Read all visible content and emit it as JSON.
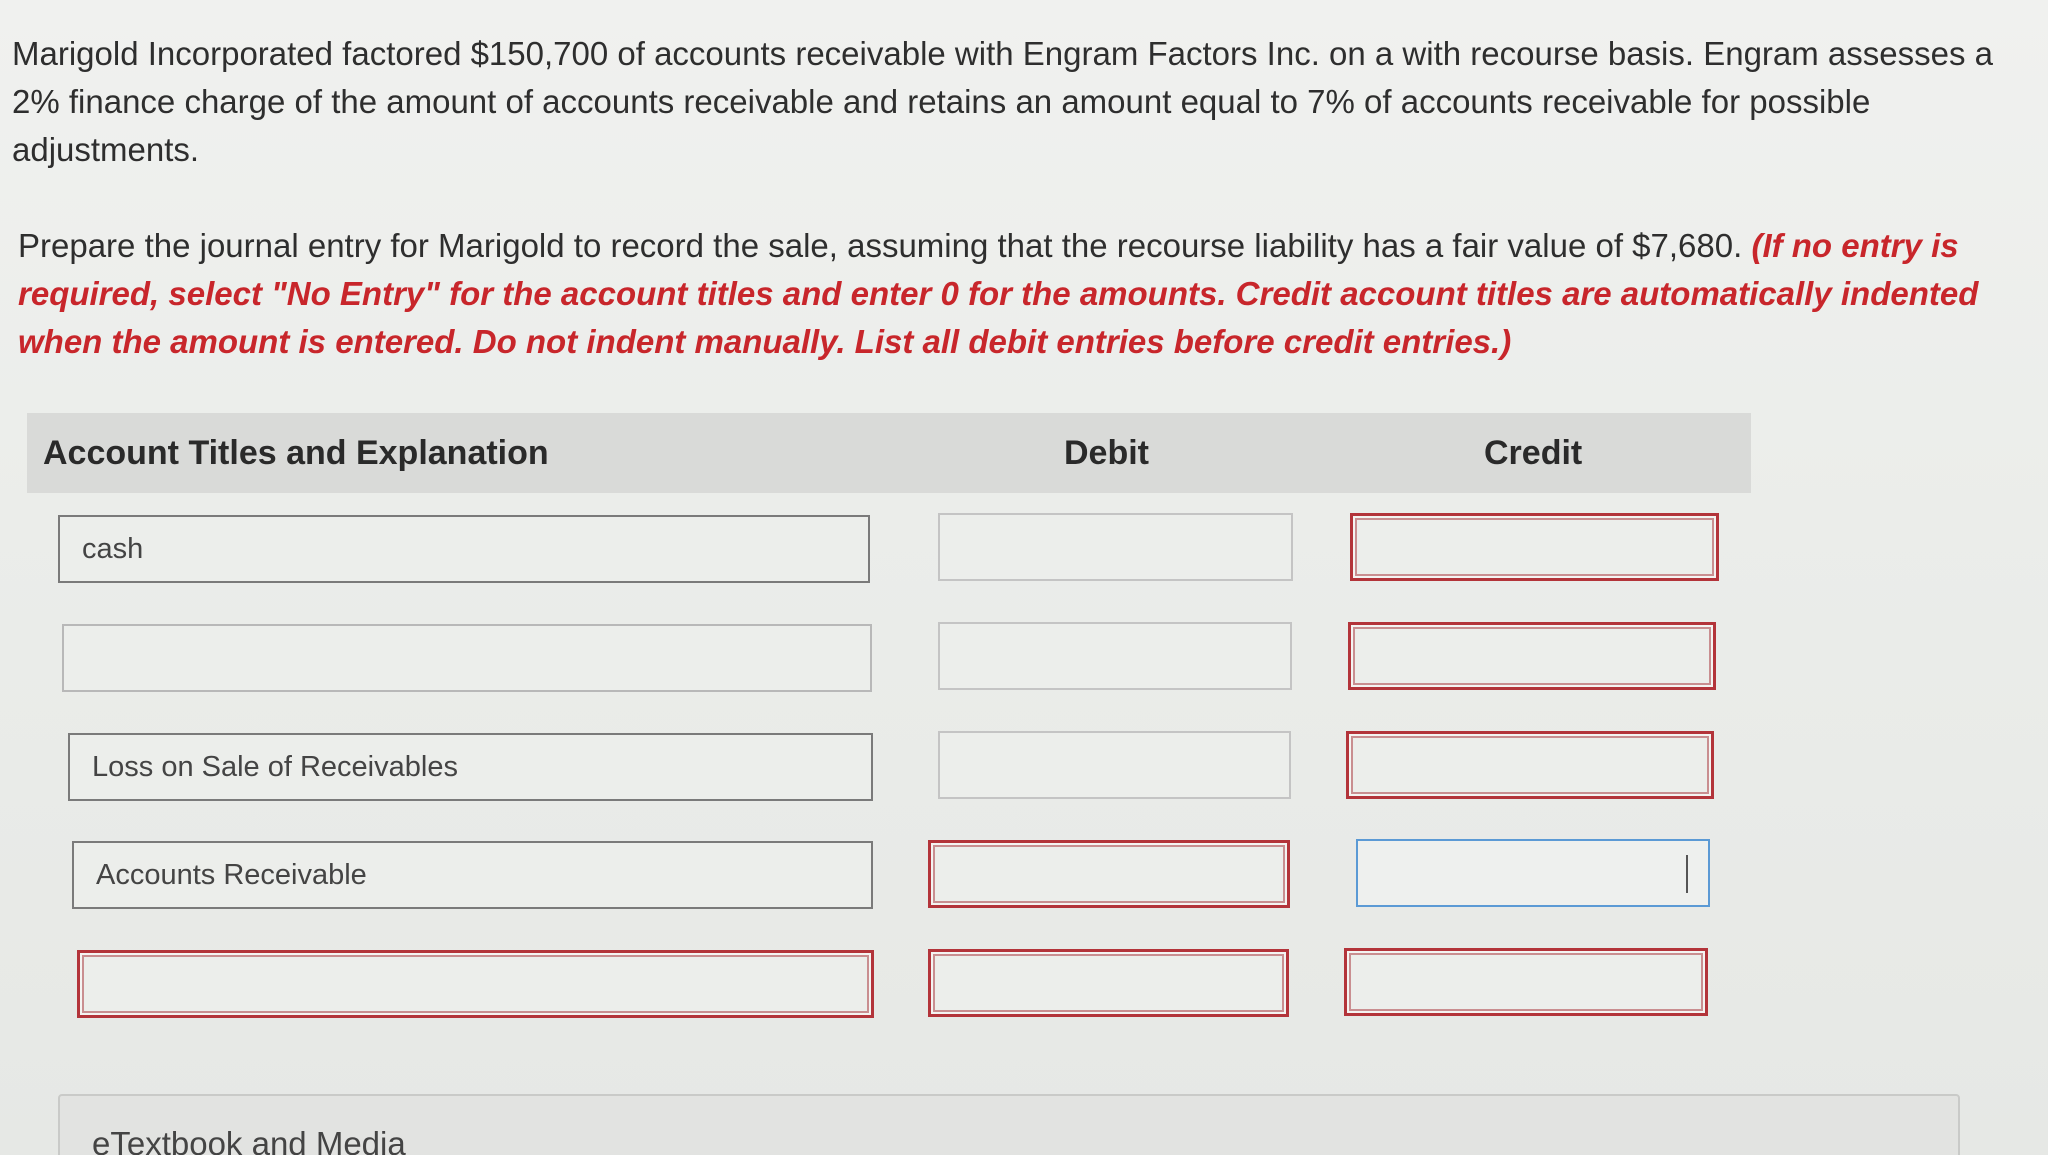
{
  "problem_text": "Marigold Incorporated factored $150,700 of accounts receivable with Engram Factors Inc. on a with recourse basis. Engram assesses a 2% finance charge of the amount of accounts receivable and retains an amount equal to 7% of accounts receivable for possible adjustments.",
  "instructions": {
    "text": "Prepare the journal entry for Marigold to record the sale, assuming that the recourse liability has a fair value of $7,680.",
    "note": "(If no entry is required, select \"No Entry\" for the account titles and enter 0 for the amounts. Credit account titles are automatically indented when the amount is entered. Do not indent manually. List all debit entries before credit entries.)"
  },
  "table": {
    "headers": {
      "account": "Account Titles and Explanation",
      "debit": "Debit",
      "credit": "Credit"
    },
    "rows": [
      {
        "account": "cash",
        "debit": "",
        "credit": ""
      },
      {
        "account": "",
        "debit": "",
        "credit": ""
      },
      {
        "account": "Loss on Sale of Receivables",
        "debit": "",
        "credit": ""
      },
      {
        "account": "Accounts Receivable",
        "debit": "",
        "credit": ""
      },
      {
        "account": "",
        "debit": "",
        "credit": ""
      }
    ]
  },
  "etextbook_label": "eTextbook and Media",
  "colors": {
    "error_border": "#b3343a",
    "instruction_red": "#c8262b",
    "focus_border": "#5b9ad5"
  }
}
